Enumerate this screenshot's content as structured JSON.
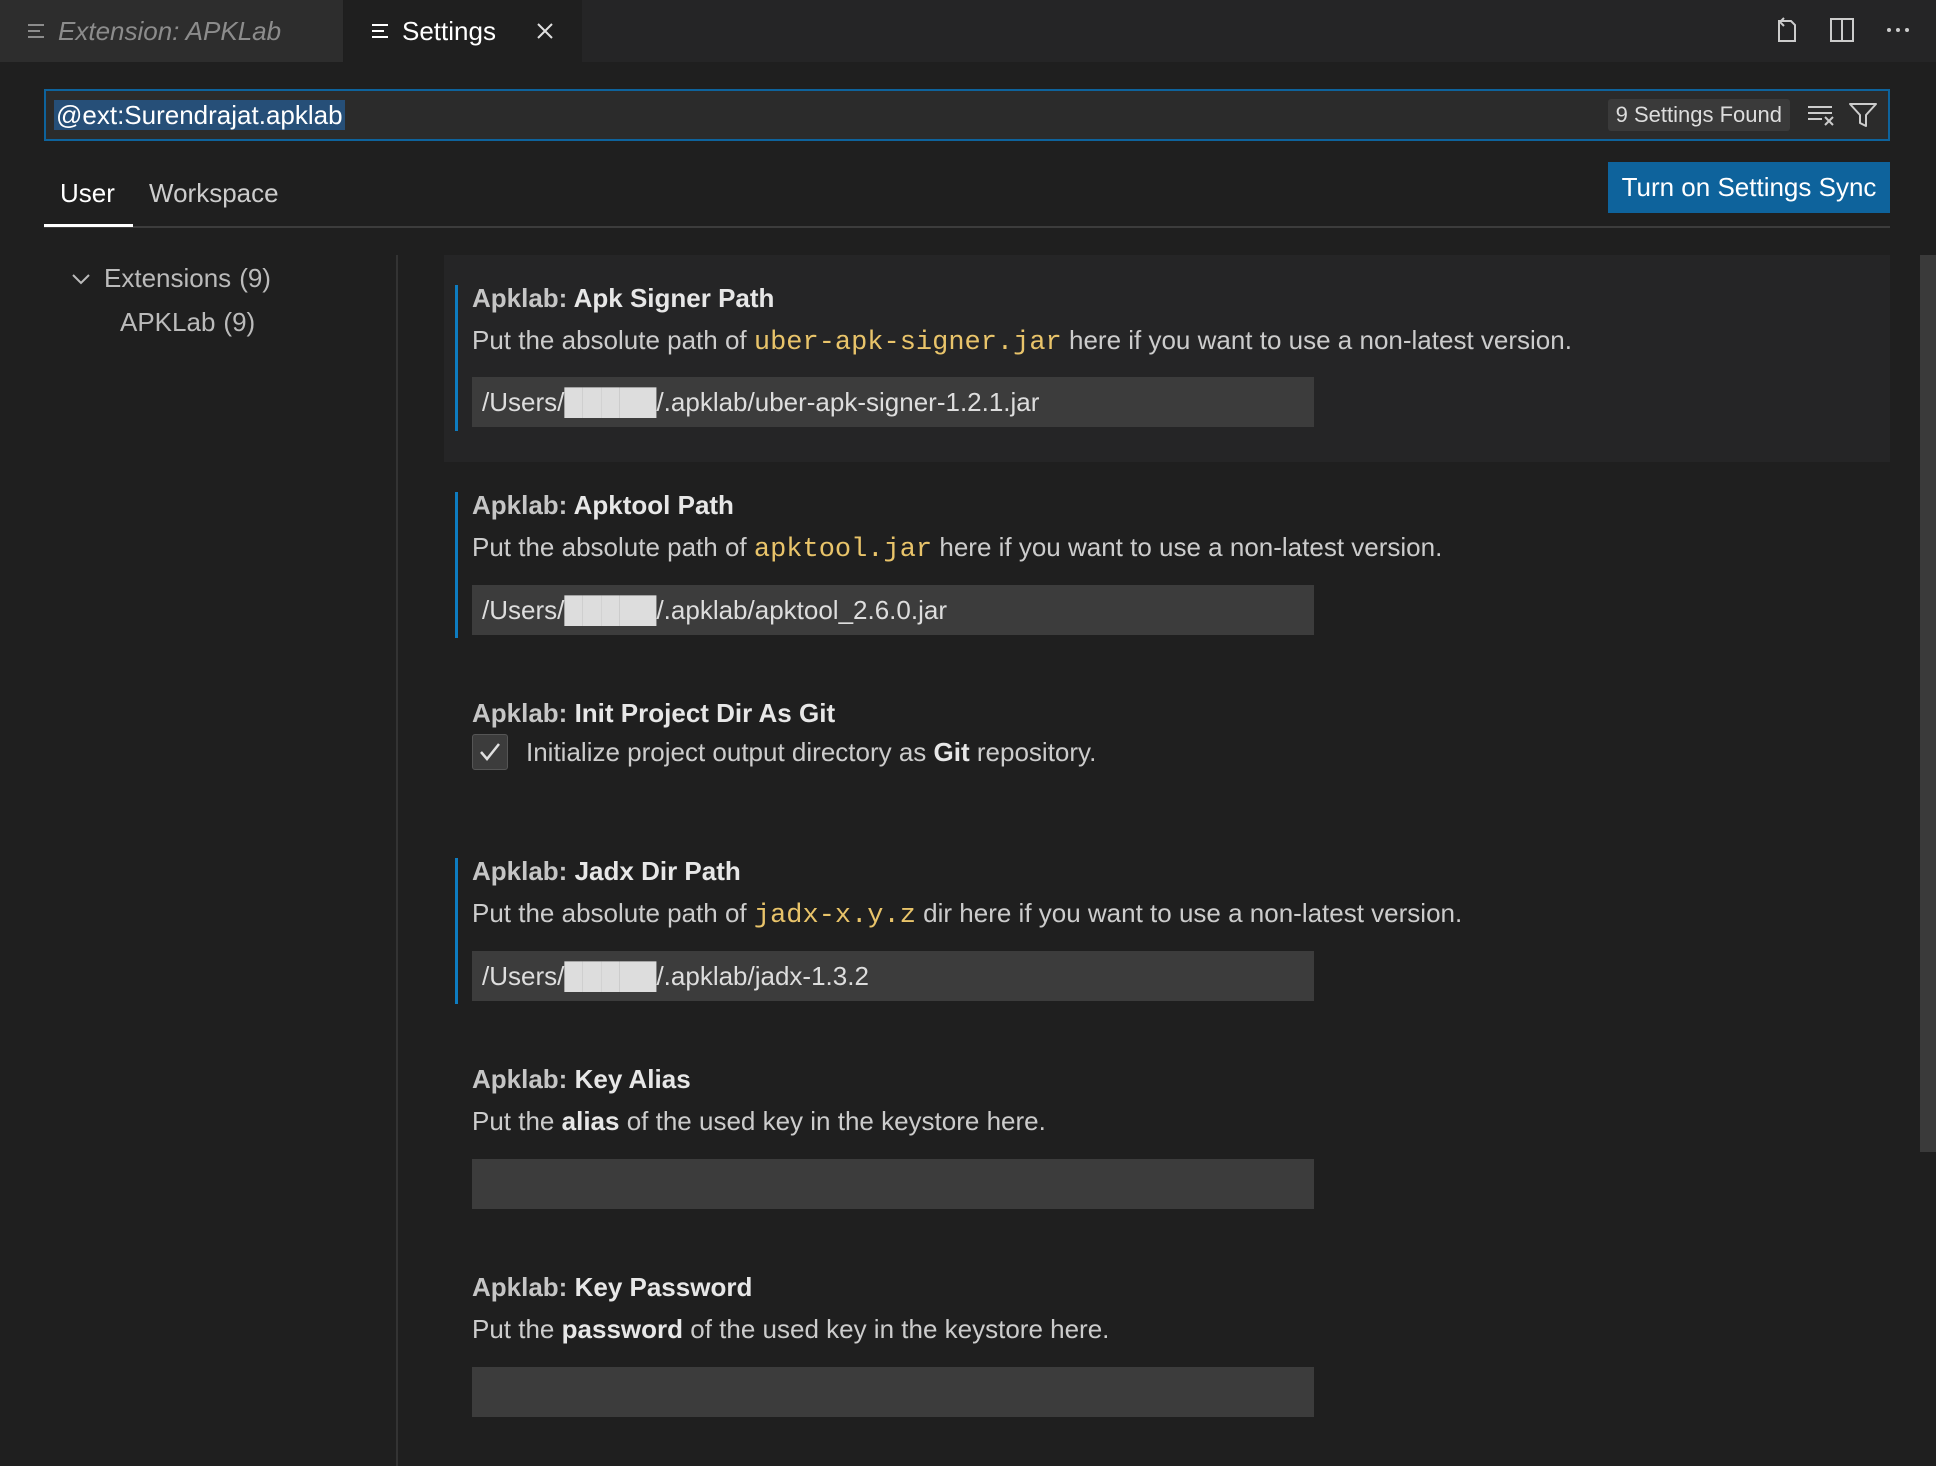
{
  "tabs": {
    "inactive_label": "Extension: APKLab",
    "active_label": "Settings"
  },
  "search": {
    "value": "@ext:Surendrajat.apklab",
    "count": "9 Settings Found"
  },
  "scope": {
    "user": "User",
    "workspace": "Workspace",
    "sync_button": "Turn on Settings Sync"
  },
  "toc": {
    "extensions": "Extensions",
    "extensions_count": "(9)",
    "apklab": "APKLab",
    "apklab_count": "(9)"
  },
  "settings": {
    "category": "Apklab:",
    "apk_signer": {
      "name": "Apk Signer Path",
      "desc_pre": "Put the absolute path of",
      "desc_code": "uber-apk-signer.jar",
      "desc_post": "here if you want to use a non-latest version.",
      "value": "/Users/█████/.apklab/uber-apk-signer-1.2.1.jar"
    },
    "apktool": {
      "name": "Apktool Path",
      "desc_pre": "Put the absolute path of",
      "desc_code": "apktool.jar",
      "desc_post": "here if you want to use a non-latest version.",
      "value": "/Users/█████/.apklab/apktool_2.6.0.jar"
    },
    "init_git": {
      "name": "Init Project Dir As Git",
      "desc_pre": "Initialize project output directory as",
      "desc_bold": "Git",
      "desc_post": "repository.",
      "checked": true
    },
    "jadx": {
      "name": "Jadx Dir Path",
      "desc_pre": "Put the absolute path of",
      "desc_code": "jadx-x.y.z",
      "desc_post": "dir here if you want to use a non-latest version.",
      "value": "/Users/█████/.apklab/jadx-1.3.2"
    },
    "key_alias": {
      "name": "Key Alias",
      "desc_pre": "Put the",
      "desc_bold": "alias",
      "desc_post": "of the used key in the keystore here.",
      "value": ""
    },
    "key_password": {
      "name": "Key Password",
      "desc_pre": "Put the",
      "desc_bold": "password",
      "desc_post": "of the used key in the keystore here.",
      "value": ""
    }
  },
  "colors": {
    "accent": "#0e639c",
    "focus_bar": "#0e7cc0",
    "code_text": "#e9c46a",
    "background": "#1f1f1f"
  }
}
